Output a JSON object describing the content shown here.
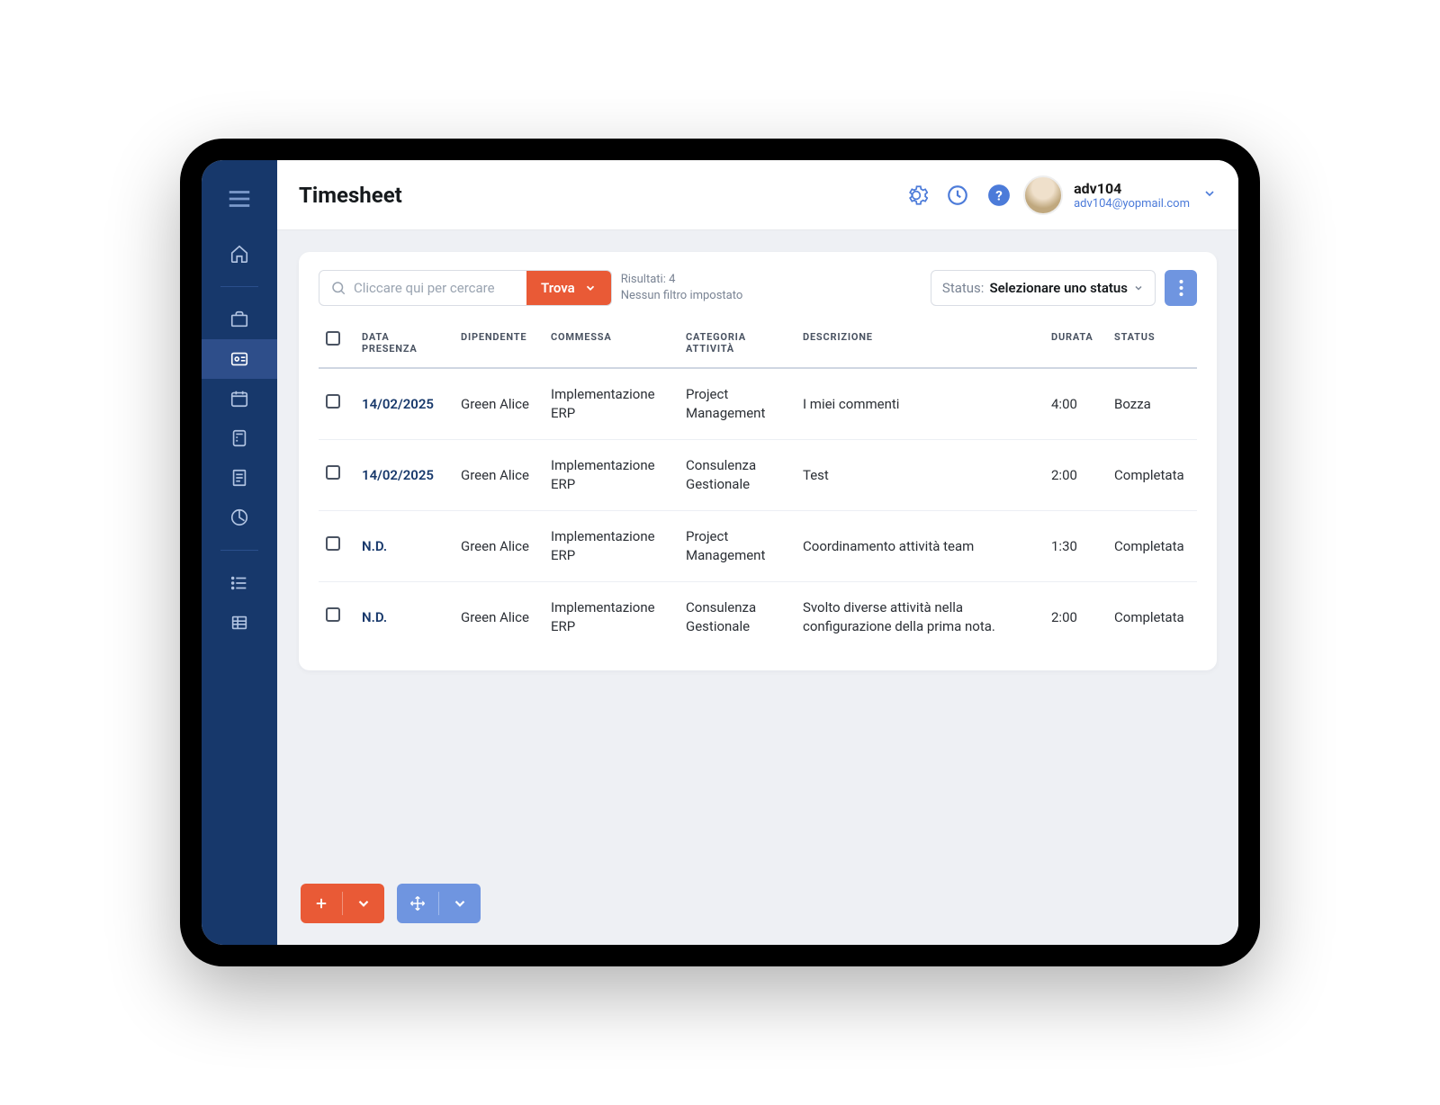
{
  "header": {
    "title": "Timesheet",
    "user_name": "adv104",
    "user_email": "adv104@yopmail.com"
  },
  "search": {
    "placeholder": "Cliccare qui per cercare",
    "find_label": "Trova",
    "results_line1": "Risultati: 4",
    "results_line2": "Nessun filtro impostato"
  },
  "status_filter": {
    "prefix": "Status: ",
    "value": "Selezionare uno status"
  },
  "columns": {
    "checkbox": "",
    "data_presenza": "DATA PRESENZA",
    "dipendente": "DIPENDENTE",
    "commessa": "COMMESSA",
    "categoria": "CATEGORIA ATTIVITÀ",
    "descrizione": "DESCRIZIONE",
    "durata": "DURATA",
    "status": "STATUS"
  },
  "rows": [
    {
      "date": "14/02/2025",
      "employee": "Green Alice",
      "commessa": "Implementazione ERP",
      "categoria": "Project Management",
      "descrizione": "I miei commenti",
      "durata": "4:00",
      "status": "Bozza"
    },
    {
      "date": "14/02/2025",
      "employee": "Green Alice",
      "commessa": "Implementazione ERP",
      "categoria": "Consulenza Gestionale",
      "descrizione": "Test",
      "durata": "2:00",
      "status": "Completata"
    },
    {
      "date": "N.D.",
      "employee": "Green Alice",
      "commessa": "Implementazione ERP",
      "categoria": "Project Management",
      "descrizione": "Coordinamento attività team",
      "durata": "1:30",
      "status": "Completata"
    },
    {
      "date": "N.D.",
      "employee": "Green Alice",
      "commessa": "Implementazione ERP",
      "categoria": "Consulenza Gestionale",
      "descrizione": "Svolto diverse attività nella configurazione della prima nota.",
      "durata": "2:00",
      "status": "Completata"
    }
  ]
}
